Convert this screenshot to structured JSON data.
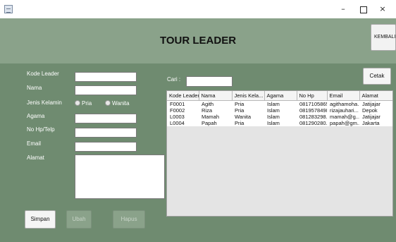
{
  "window": {
    "minimize_glyph": "–",
    "maximize_glyph": "",
    "close_glyph": "×"
  },
  "header": {
    "title": "TOUR LEADER",
    "back_label": "KEMBALI"
  },
  "form": {
    "labels": {
      "kode_leader": "Kode Leader",
      "nama": "Nama",
      "jenis_kelamin": "Jenis Kelamin",
      "agama": "Agama",
      "no_hp": "No Hp/Telp",
      "email": "Email",
      "alamat": "Alamat"
    },
    "values": {
      "kode_leader": "",
      "nama": "",
      "agama": "",
      "no_hp": "",
      "email": "",
      "alamat": ""
    },
    "gender_options": [
      "Pria",
      "Wanita"
    ],
    "buttons": {
      "simpan": "Simpan",
      "ubah": "Ubah",
      "hapus": "Hapus"
    }
  },
  "search": {
    "label": "Cari  :",
    "value": ""
  },
  "print_label": "Cetak",
  "table": {
    "columns": [
      "Kode Leader",
      "Nama",
      "Jenis Kela...",
      "Agama",
      "No Hp",
      "Email",
      "Alamat"
    ],
    "rows": [
      [
        "F0001",
        "Agith",
        "Pria",
        "Islam",
        "0817105865",
        "agithamoha...",
        "Jatijajar"
      ],
      [
        "F0002",
        "Riza",
        "Pria",
        "Islam",
        "0819578498",
        "rizajauhari...",
        "Depok"
      ],
      [
        "L0003",
        "Mamah",
        "Wanita",
        "Islam",
        "081283298...",
        "mamah@g...",
        "Jatijajar"
      ],
      [
        "L0004",
        "Papah",
        "Pria",
        "Islam",
        "081290280...",
        "papah@gm...",
        "Jakarta"
      ]
    ]
  },
  "colors": {
    "frame": "#6f8b70",
    "header": "#8aa28a"
  }
}
